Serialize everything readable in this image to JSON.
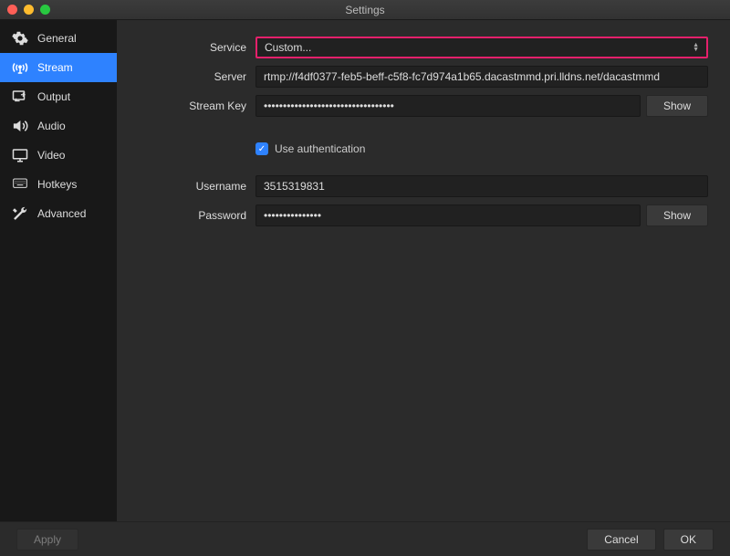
{
  "window": {
    "title": "Settings"
  },
  "sidebar": {
    "items": [
      {
        "label": "General"
      },
      {
        "label": "Stream"
      },
      {
        "label": "Output"
      },
      {
        "label": "Audio"
      },
      {
        "label": "Video"
      },
      {
        "label": "Hotkeys"
      },
      {
        "label": "Advanced"
      }
    ],
    "activeIndex": 1
  },
  "form": {
    "service": {
      "label": "Service",
      "value": "Custom..."
    },
    "server": {
      "label": "Server",
      "value": "rtmp://f4df0377-feb5-beff-c5f8-fc7d974a1b65.dacastmmd.pri.lldns.net/dacastmmd"
    },
    "streamKey": {
      "label": "Stream Key",
      "value": "••••••••••••••••••••••••••••••••••",
      "showLabel": "Show"
    },
    "auth": {
      "checkboxLabel": "Use authentication",
      "checked": true
    },
    "username": {
      "label": "Username",
      "value": "3515319831"
    },
    "password": {
      "label": "Password",
      "value": "•••••••••••••••",
      "showLabel": "Show"
    }
  },
  "footer": {
    "apply": "Apply",
    "cancel": "Cancel",
    "ok": "OK"
  }
}
